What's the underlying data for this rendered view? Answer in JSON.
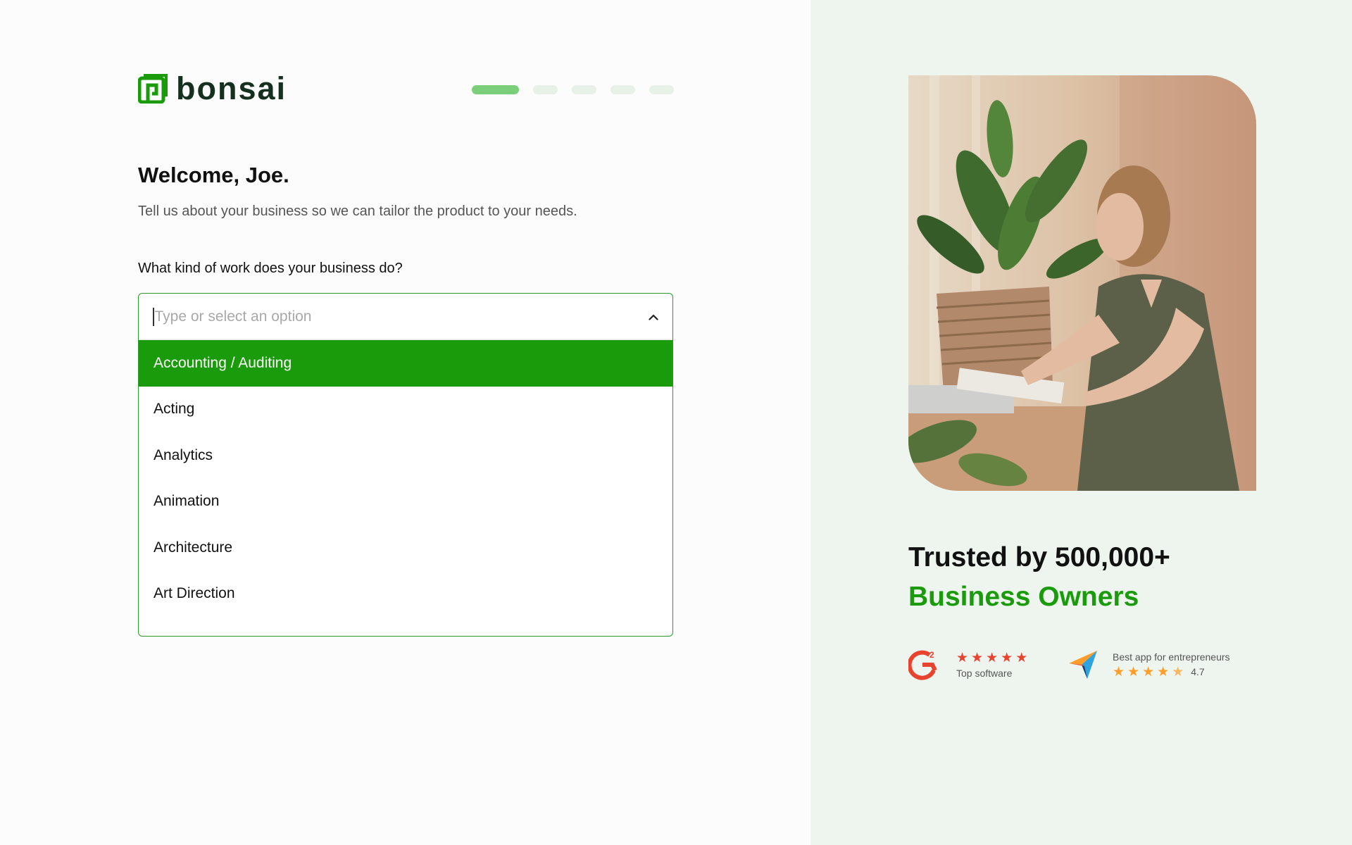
{
  "logo": {
    "text": "bonsai",
    "icon": "bonsai-logo-icon",
    "brand_color": "#1a9b0b"
  },
  "progress": {
    "total_steps": 5,
    "current_step": 1,
    "active_color": "#7bcf7b",
    "inactive_color": "#e7f1e7"
  },
  "welcome": {
    "title": "Welcome, Joe.",
    "subtitle": "Tell us about your business so we can tailor the product to your needs."
  },
  "form": {
    "question": "What kind of work does your business do?",
    "input_value": "",
    "input_placeholder": "Type or select an option",
    "options": [
      "Accounting / Auditing",
      "Acting",
      "Analytics",
      "Animation",
      "Architecture",
      "Art Direction"
    ],
    "selected_index": 0
  },
  "hero": {
    "image": "woman-working-with-plants-photo",
    "trust_line1": "Trusted by 500,000+",
    "trust_line2": "Business Owners",
    "accent_color": "#1a9b0b"
  },
  "ratings": [
    {
      "badge": "g2-logo-icon",
      "stars": 5,
      "caption": "Top software",
      "star_color": "#e8432f"
    },
    {
      "badge": "capterra-logo-icon",
      "stars": 4.5,
      "caption": "Best app for entrepreneurs",
      "score": "4.7",
      "star_color": "#ff9d28"
    }
  ]
}
